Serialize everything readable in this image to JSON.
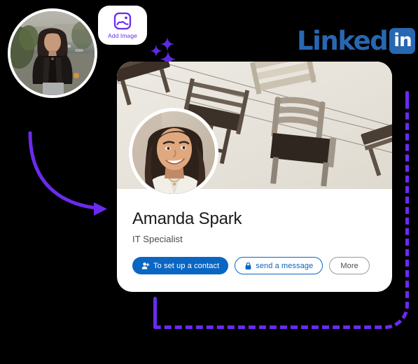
{
  "page": {
    "background_color": "#000000",
    "accent_purple": "#6A2BEF",
    "linkedin_blue": "#2867B2",
    "button_blue": "#0A66C2"
  },
  "add_image_chip": {
    "label": "Add Image",
    "icon": "image-icon",
    "icon_color": "#6A2BEF"
  },
  "brand": {
    "name": "LinkedIn",
    "wordmark": "Linked",
    "badge_text": "in",
    "color": "#2867B2"
  },
  "decorations": {
    "sparkle_icon": "sparkle-icon",
    "arrow_icon": "curved-arrow-icon",
    "dashed_frame_color": "#6A2BEF"
  },
  "source_photo": {
    "alt": "Woman in black leather jacket outdoors by a river",
    "ring_color": "#ffffff"
  },
  "profile_card": {
    "banner": {
      "alt": "Suspended wooden chairs hanging on wires against a cream wall",
      "background_color": "#e7e3dc"
    },
    "avatar": {
      "alt": "Smiling woman with wavy brown hair in a white blazer"
    },
    "name": "Amanda Spark",
    "headline": "IT Specialist",
    "actions": [
      {
        "label": "To set up a contact",
        "icon": "person-add-icon",
        "style": "primary"
      },
      {
        "label": "send a message",
        "icon": "lock-icon",
        "style": "outline-blue"
      },
      {
        "label": "More",
        "icon": "",
        "style": "outline-gray"
      }
    ]
  }
}
